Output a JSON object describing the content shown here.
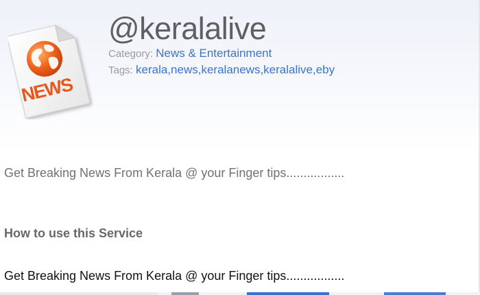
{
  "profile": {
    "handle": "@keralalive",
    "category_label": "Category:",
    "category_value": "News & Entertainment",
    "tags_label": "Tags:",
    "tags_value": "kerala,news,keralanews,keralalive,eby",
    "logo_icon": "news-document-globe-icon",
    "logo_text": "NEWS"
  },
  "content": {
    "description": "Get Breaking News From Kerala @ your Finger tips.................",
    "howto_heading": "How to use this Service",
    "howto_text": "Get Breaking News From Kerala @ your Finger tips................."
  },
  "colors": {
    "link": "#3b74c9",
    "muted": "#9a9a9e",
    "logo_orange": "#e8561c"
  }
}
